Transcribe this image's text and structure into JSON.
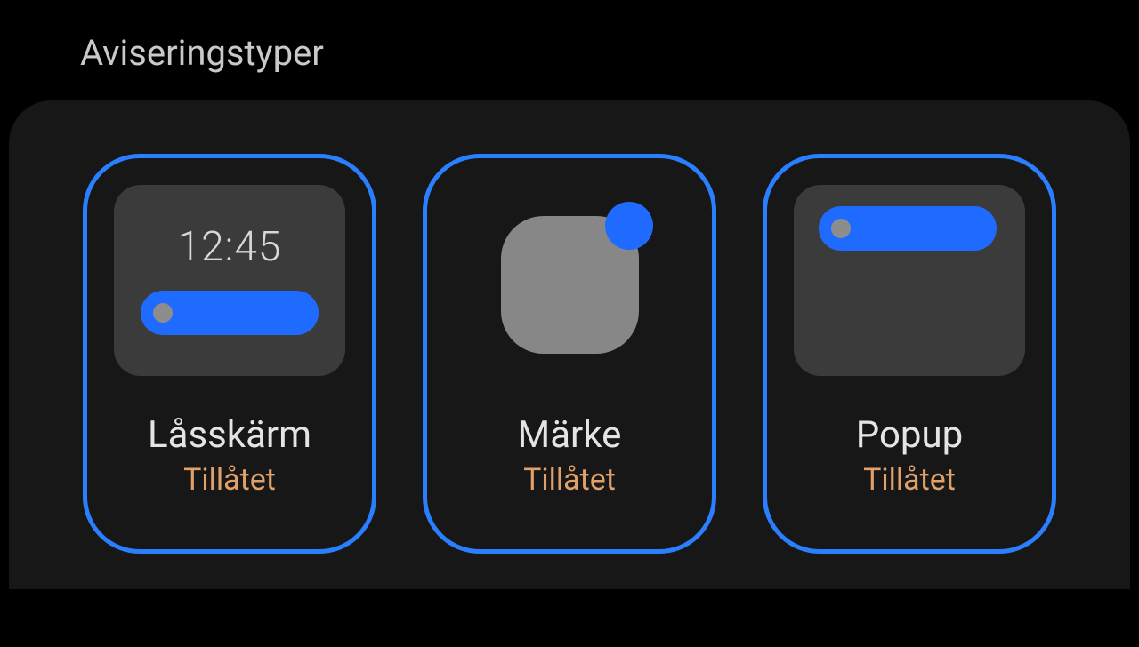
{
  "header": {
    "title": "Aviseringstyper"
  },
  "lockscreen": {
    "preview_time": "12:45",
    "title": "Låsskärm",
    "status": "Tillåtet"
  },
  "badge": {
    "title": "Märke",
    "status": "Tillåtet"
  },
  "popup": {
    "title": "Popup",
    "status": "Tillåtet"
  }
}
